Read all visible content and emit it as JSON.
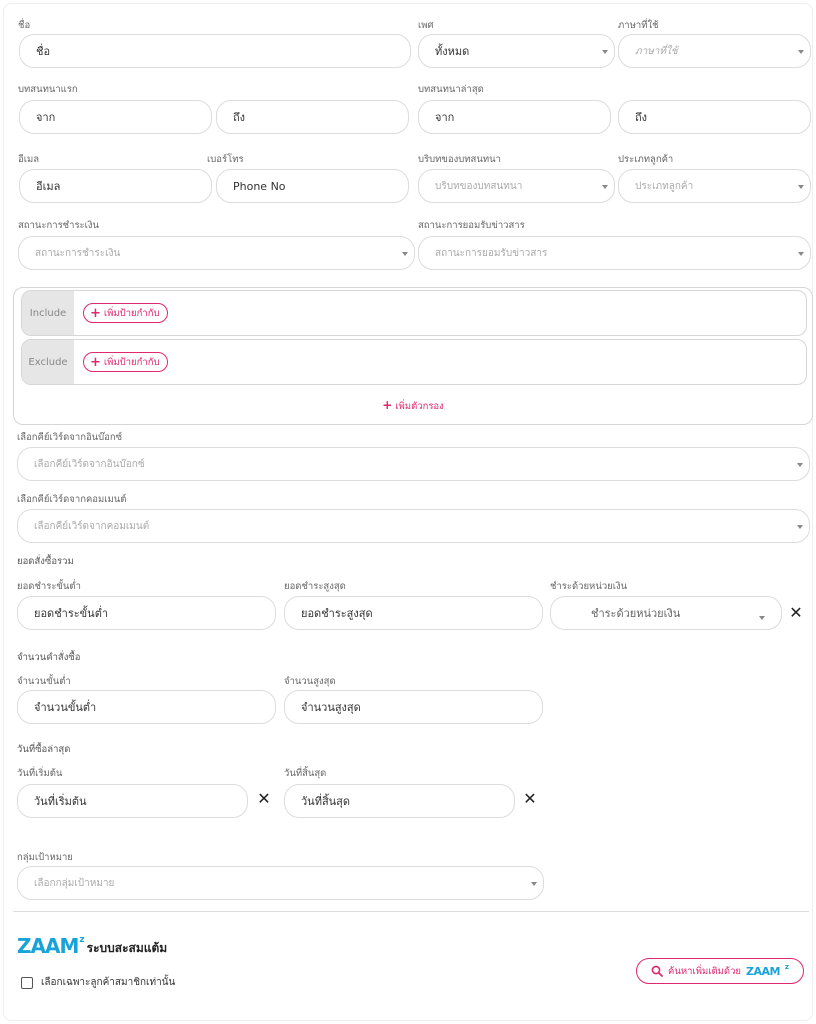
{
  "form": {
    "name": {
      "label": "ชื่อ",
      "value": "ชื่อ"
    },
    "gender": {
      "label": "เพศ",
      "value": "ทั้งหมด"
    },
    "language": {
      "label": "ภาษาที่ใช้",
      "placeholder": "ภาษาที่ใช้"
    },
    "first_conversation": {
      "label": "บทสนทนาแรก",
      "from": "จาก",
      "to": "ถึง"
    },
    "last_conversation": {
      "label": "บทสนทนาล่าสุด",
      "from": "จาก",
      "to": "ถึง"
    },
    "email": {
      "label": "อีเมล",
      "value": "อีเมล"
    },
    "phone": {
      "label": "เบอร์โทร",
      "value": "Phone No"
    },
    "conversation_context": {
      "label": "บริบทของบทสนทนา",
      "placeholder": "บริบทของบทสนทนา"
    },
    "customer_type": {
      "label": "ประเภทลูกค้า",
      "placeholder": "ประเภทลูกค้า"
    },
    "payment_status": {
      "label": "สถานะการชำระเงิน",
      "placeholder": "สถานะการชำระเงิน"
    },
    "news_consent": {
      "label": "สถานะการยอมรับข่าวสาร",
      "placeholder": "สถานะการยอมรับข่าวสาร"
    }
  },
  "tags": {
    "include_label": "Include",
    "exclude_label": "Exclude",
    "add_tag_label": "เพิ่มป้ายกำกับ",
    "add_filter_label": "เพิ่มตัวกรอง"
  },
  "keywords": {
    "inbox": {
      "label": "เลือกคีย์เวิร์ดจากอินบ๊อกซ์",
      "placeholder": "เลือกคีย์เวิร์ดจากอินบ๊อกซ์"
    },
    "comment": {
      "label": "เลือกคีย์เวิร์ดจากคอมเมนต์",
      "placeholder": "เลือกคีย์เวิร์ดจากคอมเมนต์"
    }
  },
  "order_total": {
    "title": "ยอดสั่งซื้อรวม",
    "min": {
      "label": "ยอดชำระขั้นต่ำ",
      "value": "ยอดชำระขั้นต่ำ"
    },
    "max": {
      "label": "ยอดชำระสูงสุด",
      "value": "ยอดชำระสูงสุด"
    },
    "currency": {
      "label": "ชำระด้วยหน่วยเงิน",
      "placeholder": "ชำระด้วยหน่วยเงิน"
    }
  },
  "order_count": {
    "title": "จำนวนคำสั่งซื้อ",
    "min": {
      "label": "จำนวนขั้นต่ำ",
      "value": "จำนวนขั้นต่ำ"
    },
    "max": {
      "label": "จำนวนสูงสุด",
      "value": "จำนวนสูงสุด"
    }
  },
  "last_purchase": {
    "title": "วันที่ซื้อล่าสุด",
    "start": {
      "label": "วันที่เริ่มต้น",
      "value": "วันที่เริ่มต้น"
    },
    "end": {
      "label": "วันที่สิ้นสุด",
      "value": "วันที่สิ้นสุด"
    }
  },
  "target_group": {
    "label": "กลุ่มเป้าหมาย",
    "placeholder": "เลือกกลุ่มเป้าหมาย"
  },
  "zaam": {
    "brand": "ZAAM",
    "superscript": "z",
    "title": "ระบบสะสมแต้ม",
    "members_only_label": "เลือกเฉพาะลูกค้าสมาชิกเท่านั้น",
    "search_button_label": "ค้นหาเพิ่มเติมด้วย",
    "search_button_brand": "ZAAM",
    "search_icon": "search-icon",
    "clear_icon": "close-icon"
  },
  "colors": {
    "accent": "#e0286f",
    "brand": "#1aa3d9"
  }
}
